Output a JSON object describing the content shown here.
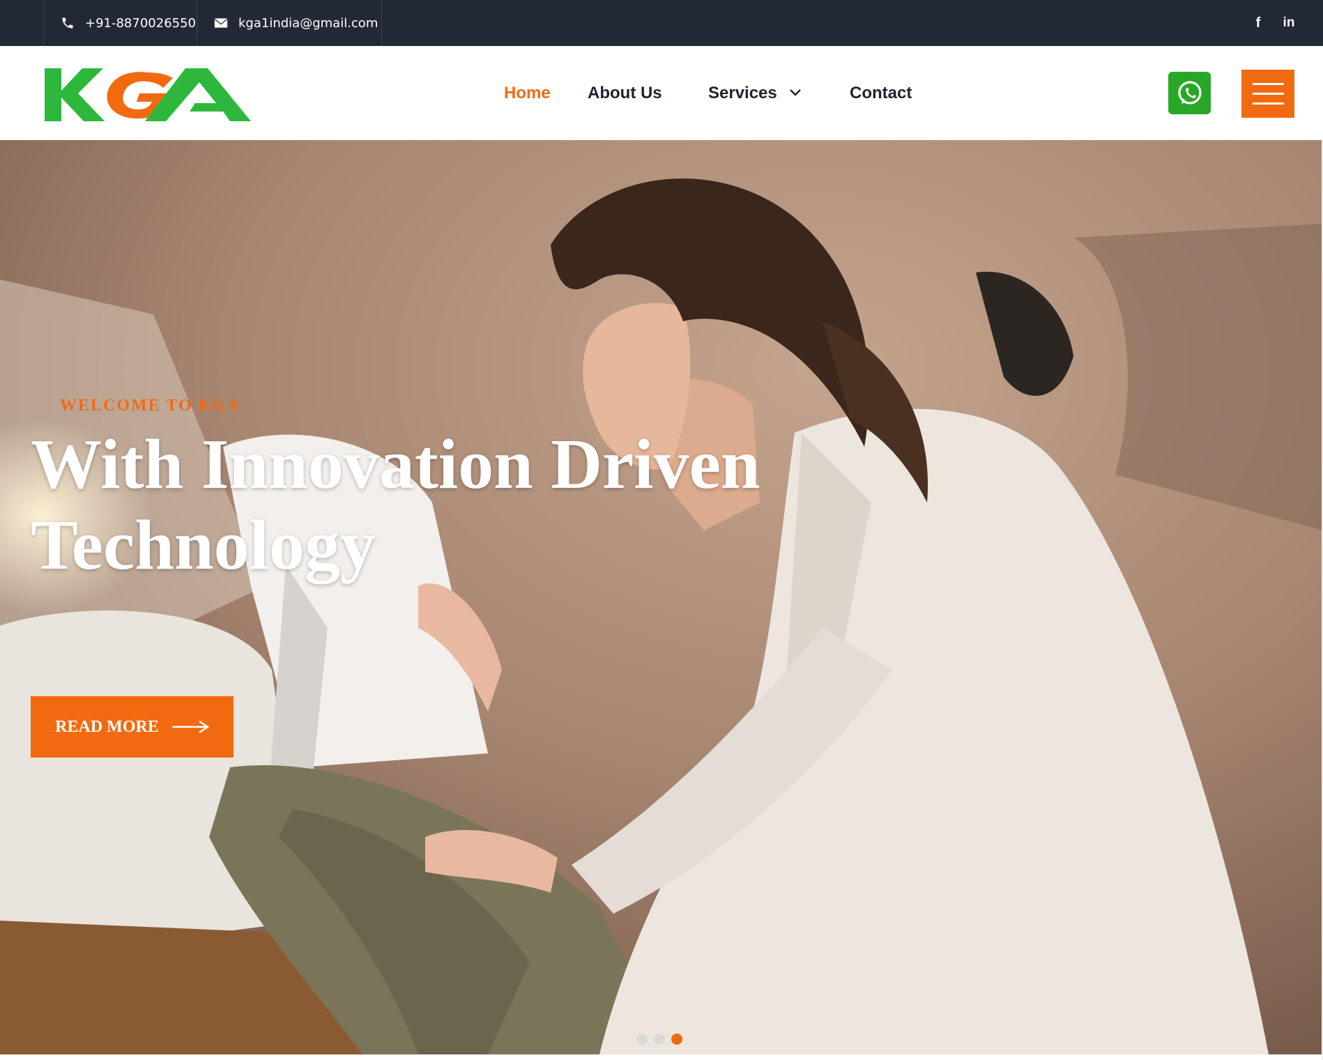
{
  "topbar": {
    "phone": "+91-8870026550",
    "email": "kga1india@gmail.com",
    "social": [
      {
        "name": "facebook-icon",
        "glyph": "f"
      },
      {
        "name": "linkedin-icon",
        "glyph": "in"
      }
    ]
  },
  "header": {
    "logo_text": "KGA",
    "nav": [
      {
        "label": "Home",
        "active": true
      },
      {
        "label": "About Us",
        "active": false
      },
      {
        "label": "Services",
        "active": false,
        "dropdown": true
      },
      {
        "label": "Contact",
        "active": false
      }
    ],
    "whatsapp_icon": "whatsapp-icon",
    "menu_icon": "hamburger-menu-icon"
  },
  "hero": {
    "eyebrow": "WELCOME TO KGA",
    "headline": "With Innovation Driven Technology",
    "cta_label": "READ MORE",
    "slider_dots": 3,
    "active_dot": 3
  },
  "colors": {
    "accent": "#f26a10",
    "topbar_bg": "#232836",
    "whatsapp_green": "#28a726",
    "logo_green": "#2db83d",
    "nav_text": "#1f2330"
  }
}
